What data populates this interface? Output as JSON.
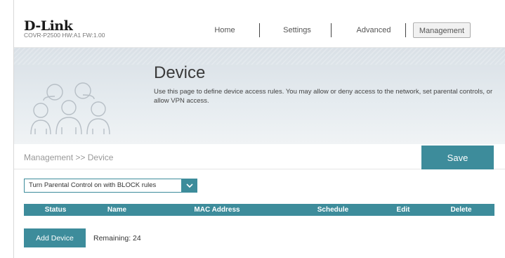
{
  "header": {
    "logo": "D-Link",
    "model": "COVR-P2500  HW:A1  FW:1.00",
    "nav": [
      {
        "label": "Home"
      },
      {
        "label": "Settings"
      },
      {
        "label": "Advanced"
      },
      {
        "label": "Management",
        "active": true
      }
    ]
  },
  "banner": {
    "title": "Device",
    "description": "Use this page to define device access rules. You may allow or deny access to the network, set parental controls, or allow VPN access."
  },
  "breadcrumb": "Management >> Device",
  "save_label": "Save",
  "rule_select": {
    "value": "Turn Parental Control on with BLOCK rules"
  },
  "table": {
    "columns": [
      "Status",
      "Name",
      "MAC Address",
      "Schedule",
      "Edit",
      "Delete"
    ]
  },
  "add_device_label": "Add Device",
  "remaining": "Remaining: 24",
  "colors": {
    "accent": "#3d8c9b"
  }
}
